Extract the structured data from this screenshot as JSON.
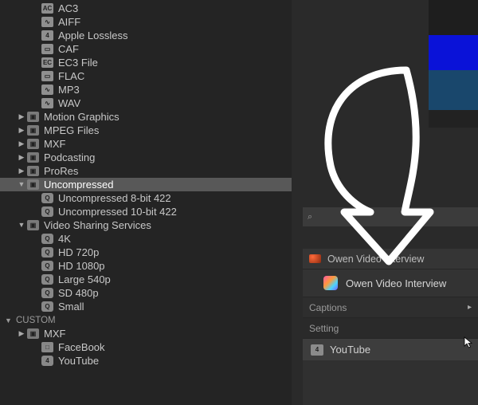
{
  "tree": {
    "audio_items": [
      {
        "label": "AC3",
        "icon": "AC"
      },
      {
        "label": "AIFF",
        "icon": "∿"
      },
      {
        "label": "Apple Lossless",
        "icon": "4"
      },
      {
        "label": "CAF",
        "icon": "▭"
      },
      {
        "label": "EC3 File",
        "icon": "EC"
      },
      {
        "label": "FLAC",
        "icon": "▭"
      },
      {
        "label": "MP3",
        "icon": "∿"
      },
      {
        "label": "WAV",
        "icon": "∿"
      }
    ],
    "folders_collapsed": [
      {
        "label": "Motion Graphics"
      },
      {
        "label": "MPEG Files"
      },
      {
        "label": "MXF"
      },
      {
        "label": "Podcasting"
      },
      {
        "label": "ProRes"
      }
    ],
    "uncompressed": {
      "label": "Uncompressed",
      "children": [
        {
          "label": "Uncompressed 8-bit 422"
        },
        {
          "label": "Uncompressed 10-bit 422"
        }
      ]
    },
    "video_sharing": {
      "label": "Video Sharing Services",
      "children": [
        {
          "label": "4K"
        },
        {
          "label": "HD 720p"
        },
        {
          "label": "HD 1080p"
        },
        {
          "label": "Large 540p"
        },
        {
          "label": "SD 480p"
        },
        {
          "label": "Small"
        }
      ]
    },
    "custom_header": "CUSTOM",
    "custom": [
      {
        "label": "MXF",
        "kind": "folder"
      },
      {
        "label": "FaceBook",
        "kind": "device"
      },
      {
        "label": "YouTube",
        "kind": "preset",
        "icon": "4"
      }
    ]
  },
  "panel": {
    "header_title": "Owen Video Interview",
    "project_title": "Owen Video Interview",
    "captions_label": "Captions",
    "setting_label": "Setting",
    "setting_value": "YouTube",
    "setting_icon": "4"
  }
}
